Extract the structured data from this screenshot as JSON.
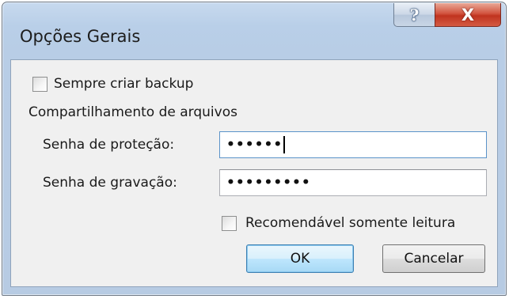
{
  "window": {
    "title": "Opções Gerais",
    "help_glyph": "?",
    "close_glyph": "X"
  },
  "options": {
    "always_backup_label": "Sempre criar backup",
    "always_backup_checked": false
  },
  "sharing": {
    "heading": "Compartilhamento de arquivos",
    "protection_password_label": "Senha de proteção:",
    "protection_password_mask": "••••••",
    "write_password_label": "Senha de gravação:",
    "write_password_mask": "•••••••••",
    "read_only_label": "Recomendável somente leitura",
    "read_only_checked": false
  },
  "buttons": {
    "ok": "OK",
    "cancel": "Cancelar"
  }
}
